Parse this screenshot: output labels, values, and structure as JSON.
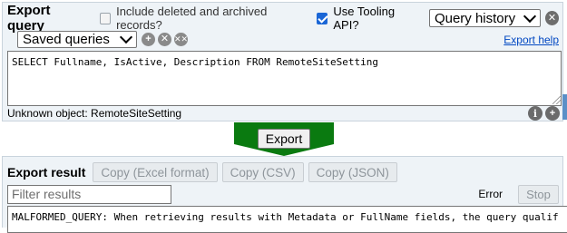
{
  "query": {
    "title": "Export query",
    "include_deleted_label": "Include deleted and archived records?",
    "include_deleted_checked": false,
    "tooling_api_label": "Use Tooling API?",
    "tooling_api_checked": true,
    "history_select": "Query history",
    "history_clear_icon": "x-icon",
    "saved_select": "Saved queries",
    "saved_add_icon": "plus-icon",
    "saved_remove_icon": "x-icon",
    "saved_clear_icon": "clear-all-icon",
    "export_help": "Export help",
    "text": "SELECT Fullname, IsActive, Description FROM RemoteSiteSetting",
    "status": "Unknown object: RemoteSiteSetting"
  },
  "export_button": "Export",
  "result": {
    "title": "Export result",
    "copy_excel": "Copy (Excel format)",
    "copy_csv": "Copy (CSV)",
    "copy_json": "Copy (JSON)",
    "filter_placeholder": "Filter results",
    "error_label": "Error",
    "stop_label": "Stop",
    "message": "MALFORMED_QUERY: When retrieving results with Metadata or FullName fields, the query qualif"
  },
  "colors": {
    "panel_bg": "#eef3f7",
    "export_band": "#0a7a10",
    "link": "#0047c2",
    "checkbox_on": "#1a66d6"
  }
}
